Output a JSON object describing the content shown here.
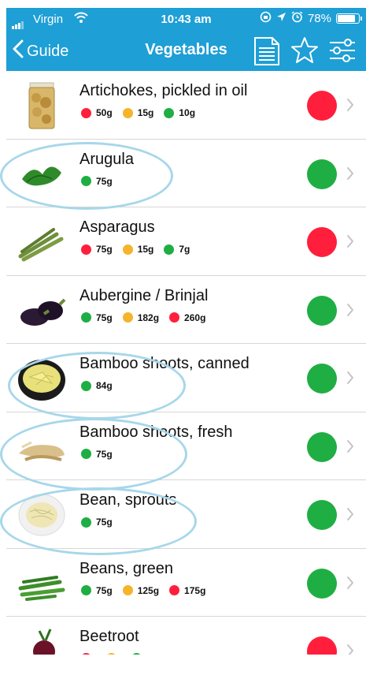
{
  "status_bar": {
    "carrier": "Virgin",
    "time": "10:43 am",
    "battery": "78%"
  },
  "nav": {
    "back_label": "Guide",
    "title": "Vegetables"
  },
  "colors": {
    "header": "#1e9fd6",
    "red": "#ff1f3d",
    "amber": "#f5b42a",
    "green": "#1fae43",
    "highlight": "#a7d7ea"
  },
  "items": [
    {
      "name": "Artichokes, pickled in oil",
      "status": "red",
      "image": "pickled-artichoke-jar-image",
      "portions": [
        {
          "color": "red",
          "amount": "50g"
        },
        {
          "color": "amber",
          "amount": "15g"
        },
        {
          "color": "green",
          "amount": "10g"
        }
      ]
    },
    {
      "name": "Arugula",
      "status": "green",
      "image": "arugula-image",
      "highlighted": true,
      "portions": [
        {
          "color": "green",
          "amount": "75g"
        }
      ]
    },
    {
      "name": "Asparagus",
      "status": "red",
      "image": "asparagus-image",
      "portions": [
        {
          "color": "red",
          "amount": "75g"
        },
        {
          "color": "amber",
          "amount": "15g"
        },
        {
          "color": "green",
          "amount": "7g"
        }
      ]
    },
    {
      "name": "Aubergine / Brinjal",
      "status": "green",
      "image": "aubergine-image",
      "portions": [
        {
          "color": "green",
          "amount": "75g"
        },
        {
          "color": "amber",
          "amount": "182g"
        },
        {
          "color": "red",
          "amount": "260g"
        }
      ]
    },
    {
      "name": "Bamboo shoots, canned",
      "status": "green",
      "image": "canned-bamboo-shoots-image",
      "highlighted": true,
      "portions": [
        {
          "color": "green",
          "amount": "84g"
        }
      ]
    },
    {
      "name": "Bamboo shoots, fresh",
      "status": "green",
      "image": "fresh-bamboo-shoots-image",
      "highlighted": true,
      "portions": [
        {
          "color": "green",
          "amount": "75g"
        }
      ]
    },
    {
      "name": "Bean, sprouts",
      "status": "green",
      "image": "bean-sprouts-image",
      "highlighted": true,
      "portions": [
        {
          "color": "green",
          "amount": "75g"
        }
      ]
    },
    {
      "name": "Beans, green",
      "status": "green",
      "image": "green-beans-image",
      "portions": [
        {
          "color": "green",
          "amount": "75g"
        },
        {
          "color": "amber",
          "amount": "125g"
        },
        {
          "color": "red",
          "amount": "175g"
        }
      ]
    },
    {
      "name": "Beetroot",
      "status": "red",
      "image": "beetroot-image",
      "portions": [
        {
          "color": "red",
          "amount": ""
        },
        {
          "color": "amber",
          "amount": ""
        },
        {
          "color": "green",
          "amount": ""
        }
      ]
    }
  ]
}
